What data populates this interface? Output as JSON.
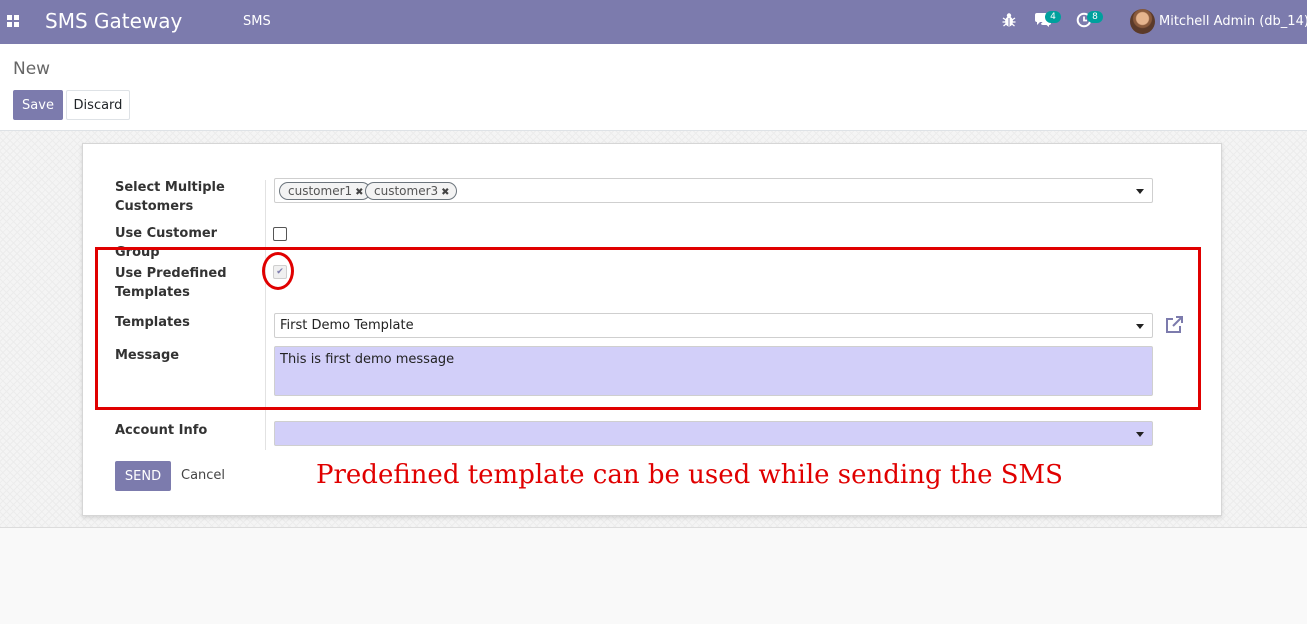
{
  "navbar": {
    "app_name": "SMS Gateway",
    "menu_sms": "SMS",
    "messages_count": "4",
    "activities_count": "8",
    "user_name": "Mitchell Admin (db_14)",
    "bg_color": "#7c7bad"
  },
  "control_panel": {
    "breadcrumb": "New",
    "save_label": "Save",
    "discard_label": "Discard"
  },
  "form": {
    "customers_label": "Select Multiple Customers",
    "customer_tags": [
      "customer1",
      "customer3"
    ],
    "customer_group_label": "Use Customer Group",
    "use_customer_group": false,
    "predefined_label": "Use Predefined Templates",
    "use_predefined_templates": true,
    "templates_label": "Templates",
    "template_value": "First Demo Template",
    "message_label": "Message",
    "message_value": "This is first demo message",
    "account_label": "Account Info",
    "account_value": "",
    "send_label": "SEND",
    "cancel_label": "Cancel"
  },
  "annotation": {
    "caption": "Predefined template can be used while sending the SMS",
    "color": "#e00000"
  },
  "icons": {
    "apps": "apps-grid-icon",
    "bug": "bug-icon",
    "chat": "chat-icon",
    "activity": "clock-icon",
    "external": "external-link-icon",
    "dropdown": "caret-down-icon",
    "remove_tag": "close-icon"
  }
}
